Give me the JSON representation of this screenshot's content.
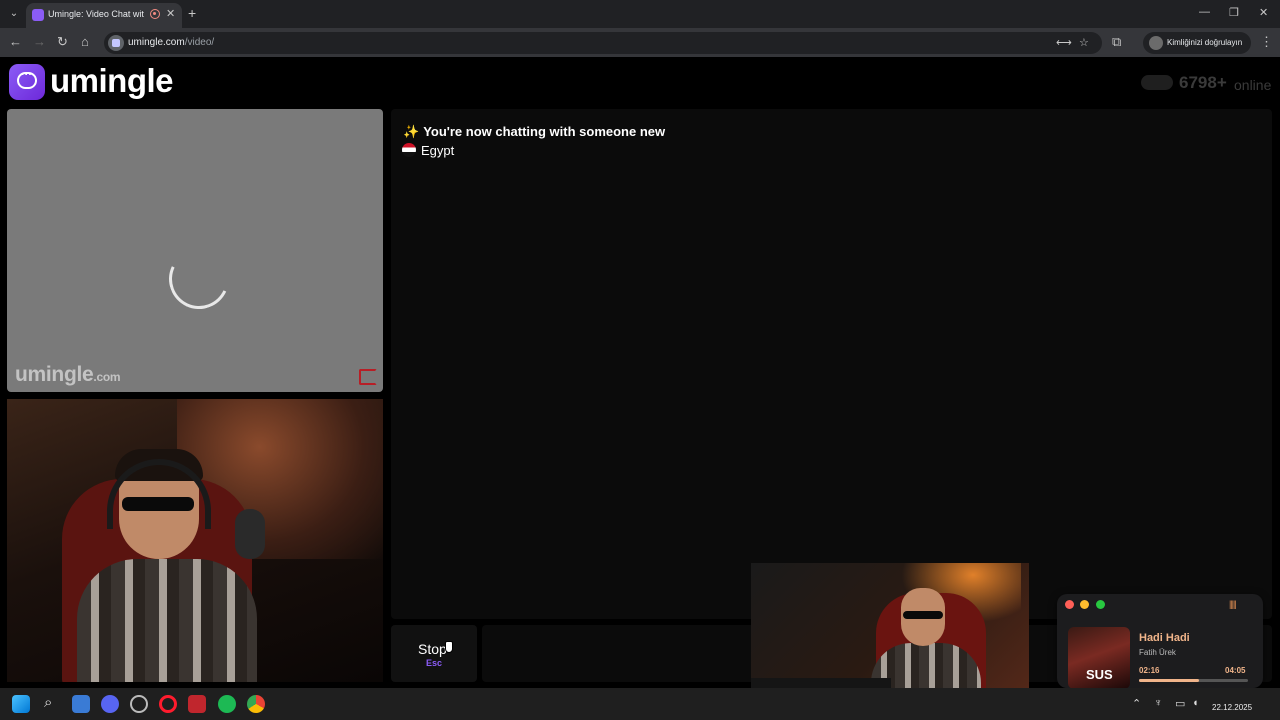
{
  "browser": {
    "tab_title": "Umingle: Video Chat with S",
    "tab_close": "✕",
    "new_tab": "+",
    "url_host": "umingle.com",
    "url_path": "/video/",
    "profile_label": "Kimliğinizi doğrulayın",
    "window_controls": {
      "minimize": "—",
      "restore": "❐",
      "close": "✕"
    },
    "icons": [
      "tab-list-icon",
      "back-icon",
      "forward-icon",
      "reload-icon",
      "home-icon",
      "translate-icon",
      "star-icon",
      "extensions-icon",
      "menu-icon"
    ]
  },
  "site": {
    "logo_text": "umingle",
    "online_count": "6798+",
    "online_label": "online",
    "watermark": "umingle",
    "watermark_suffix": ".com"
  },
  "chat": {
    "status_message": "You're now chatting with someone new",
    "country": "Egypt",
    "stop_label": "Stop",
    "stop_shortcut": "Esc"
  },
  "music_widget": {
    "song_title": "Hadi Hadi",
    "artist": "Fatih Ürek",
    "album_art_text": "SUS",
    "current_time": "02:16",
    "total_time": "04:05",
    "progress_fraction": 0.555
  },
  "taskbar": {
    "date": "22.12.2025",
    "icons": [
      "windows-start-icon",
      "search-icon",
      "app-icon",
      "discord-icon",
      "app2-icon",
      "opera-icon",
      "app3-icon",
      "spotify-icon",
      "chrome-icon"
    ]
  },
  "colors": {
    "brand": "#8b5cf6",
    "spotify": "#1db954",
    "discord": "#5865f2",
    "opera": "#ff1b2d"
  }
}
